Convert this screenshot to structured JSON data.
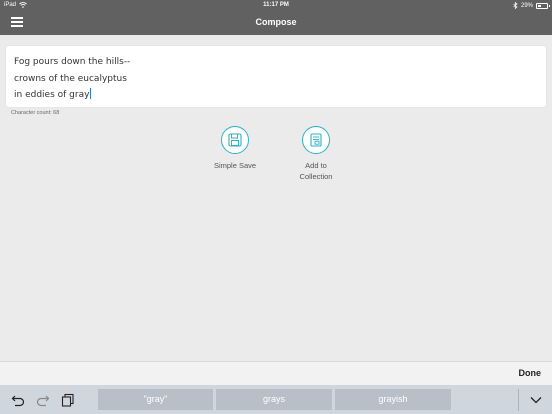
{
  "status": {
    "device": "iPad",
    "time": "11:17 PM",
    "battery": "29%",
    "battery_level": 0.29
  },
  "navbar": {
    "title": "Compose"
  },
  "editor": {
    "lines": [
      "Fog pours down the hills--",
      "crowns of the eucalyptus",
      "in eddies of gray"
    ]
  },
  "charcount": "Character count: 68",
  "actions": {
    "save_label": "Simple Save",
    "add_label_line1": "Add to",
    "add_label_line2": "Collection"
  },
  "done_label": "Done",
  "suggestions": [
    "\"gray\"",
    "grays",
    "grayish"
  ],
  "icons": {
    "menu": "hamburger-icon",
    "wifi": "wifi-icon",
    "bluetooth": "bluetooth-icon",
    "battery": "battery-icon",
    "save": "floppy-disk-icon",
    "add": "collection-add-icon",
    "undo": "undo-icon",
    "redo": "redo-icon",
    "paste": "paste-icon",
    "hide_keyboard": "chevron-down-icon"
  },
  "colors": {
    "nav": "#616161",
    "accent": "#2ab3c1",
    "cursor": "#2a7bd4",
    "suggestion_bg": "#b8bfc9",
    "keyboard_bar": "#d0d6de"
  }
}
